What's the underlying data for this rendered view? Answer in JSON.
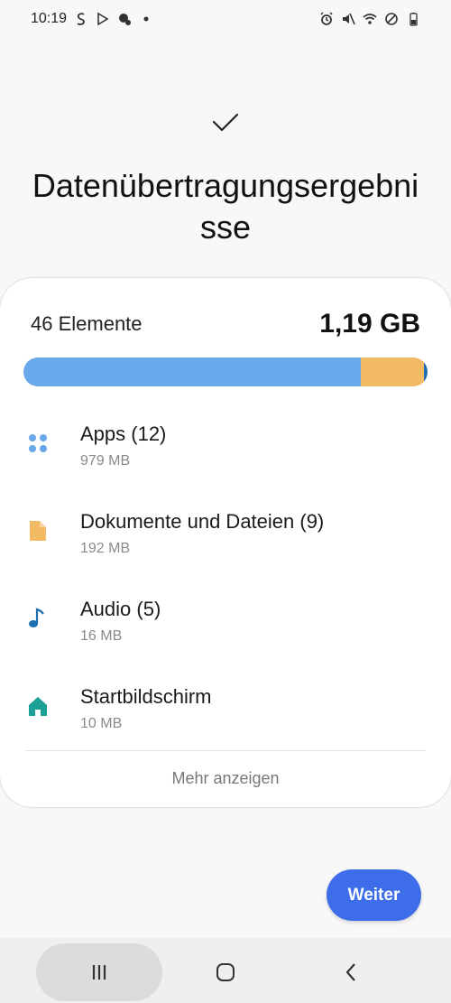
{
  "status_bar": {
    "time": "10:19",
    "left_icons": [
      "sync-icon",
      "play-store-icon",
      "tips-icon",
      "dot-icon"
    ],
    "right_icons": [
      "alarm-icon",
      "mute-icon",
      "wifi-icon",
      "do-not-disturb-icon",
      "battery-icon"
    ]
  },
  "header": {
    "title": "Datenübertragungsergebnisse"
  },
  "summary": {
    "count_label": "46 Elemente",
    "total_size": "1,19 GB"
  },
  "usage_bar": {
    "segments": [
      {
        "name": "apps",
        "fraction": 0.835,
        "color": "#6aa8ec"
      },
      {
        "name": "documents",
        "fraction": 0.155,
        "color": "#f2ba62"
      },
      {
        "name": "audio",
        "fraction": 0.01,
        "color": "#1e6fb0"
      }
    ]
  },
  "categories": [
    {
      "label": "Apps (12)",
      "size": "979 MB",
      "icon": "apps-grid-icon",
      "color": "#6aa8ec"
    },
    {
      "label": "Dokumente und Dateien (9)",
      "size": "192 MB",
      "icon": "document-icon",
      "color": "#f2ba62"
    },
    {
      "label": "Audio (5)",
      "size": "16 MB",
      "icon": "music-note-icon",
      "color": "#1e6fb0"
    },
    {
      "label": "Startbildschirm",
      "size": "10 MB",
      "icon": "home-icon",
      "color": "#1aa094"
    }
  ],
  "more_link": "Mehr anzeigen",
  "next_button": "Weiter",
  "nav_bar": {
    "buttons": [
      "recent-apps-icon",
      "home-button-icon",
      "back-icon"
    ]
  }
}
